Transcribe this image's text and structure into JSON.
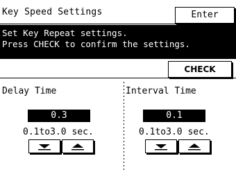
{
  "header": {
    "title": "Key Speed Settings",
    "enter_label": "Enter"
  },
  "banner": {
    "line1": "Set Key Repeat settings.",
    "line2": "Press CHECK to confirm the settings."
  },
  "check_label": "CHECK",
  "delay": {
    "label": "Delay Time",
    "value": "0.3",
    "range": "0.1to3.0 sec."
  },
  "interval": {
    "label": "Interval Time",
    "value": "0.1",
    "range": "0.1to3.0 sec."
  }
}
